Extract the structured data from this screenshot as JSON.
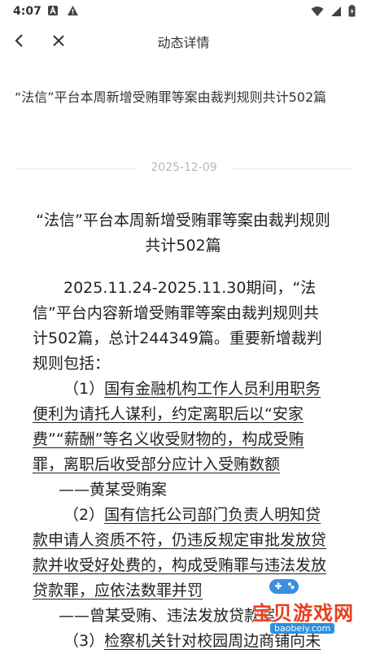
{
  "status_bar": {
    "time": "4:07",
    "left_icons": [
      "a-box-icon",
      "warning-icon"
    ],
    "right_icons": [
      "wifi-icon",
      "signal-icon",
      "battery-icon"
    ]
  },
  "nav": {
    "back_icon": "chevron-left-icon",
    "close_icon": "close-icon",
    "title": "动态详情"
  },
  "headline": "“法信”平台本周新增受贿罪等案由裁判规则共计502篇",
  "date": "2025-12-09",
  "article": {
    "title": "“法信”平台本周新增受贿罪等案由裁判规则共计502篇",
    "intro": "2025.11.24-2025.11.30期间，“法信”平台内容新增受贿罪等案由裁判规则共计502篇，总计244349篇。重要新增裁判规则包括：",
    "items": [
      {
        "num": "（1）",
        "text": "国有金融机构工作人员利用职务便利为请托人谋利，约定离职后以“安家费”“薪酬”等名义收受财物的，构成受贿罪，离职后收受部分应计入受贿数额",
        "case": "——黄某受贿案"
      },
      {
        "num": "（2）",
        "text": "国有信托公司部门负责人明知贷款申请人资质不符，仍违反规定审批发放贷款并收受好处费的，构成受贿罪与违法发放贷款罪，应依法数罪并罚",
        "case": "——曾某受贿、违法发放贷款案"
      },
      {
        "num": "（3）",
        "text": "检察机关针对校园周边商铺向未",
        "case": ""
      }
    ]
  },
  "watermark": {
    "text": "宝贝游戏网",
    "url": "baobeiy.com"
  },
  "colors": {
    "accent_watermark": "#e83f1c",
    "date_gray": "#b8b8b8",
    "divider": "#e5e5e5"
  }
}
